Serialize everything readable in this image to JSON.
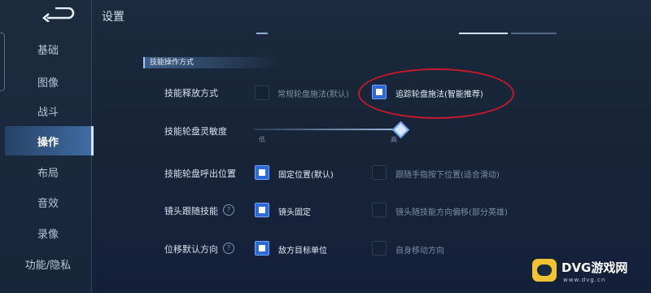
{
  "sidebar": {
    "items": [
      {
        "label": "基础"
      },
      {
        "label": "图像"
      },
      {
        "label": "战斗"
      },
      {
        "label": "操作",
        "active": true
      },
      {
        "label": "布局"
      },
      {
        "label": "音效"
      },
      {
        "label": "录像"
      },
      {
        "label": "功能/隐私"
      }
    ]
  },
  "page": {
    "title": "设置",
    "section_header": "技能操作方式"
  },
  "rows": {
    "release": {
      "label": "技能释放方式",
      "options": [
        {
          "text": "常规轮盘施法(默认)",
          "checked": false
        },
        {
          "text": "追踪轮盘施法(智能推荐)",
          "checked": true
        }
      ]
    },
    "sensitivity": {
      "label": "技能轮盘灵敏度",
      "min_label": "低",
      "max_label": "高",
      "value": 1.0
    },
    "position": {
      "label": "技能轮盘呼出位置",
      "options": [
        {
          "text": "固定位置(默认)",
          "checked": true
        },
        {
          "text": "跟随手指按下位置(适合滑动)",
          "checked": false
        }
      ]
    },
    "camera": {
      "label": "镜头跟随技能",
      "options": [
        {
          "text": "镜头固定",
          "checked": true
        },
        {
          "text": "镜头随技能方向偏移(部分英雄)",
          "checked": false
        }
      ]
    },
    "move": {
      "label": "位移默认方向",
      "options": [
        {
          "text": "敌方目标单位",
          "checked": true
        },
        {
          "text": "自身移动方向",
          "checked": false
        }
      ]
    }
  },
  "help_glyph": "?",
  "watermark": {
    "title": "DVG游戏网",
    "url": "www.dvg.cn"
  },
  "colors": {
    "accent": "#2e6ad6",
    "highlight_circle": "#c8182a",
    "logo": "#f1c232"
  }
}
